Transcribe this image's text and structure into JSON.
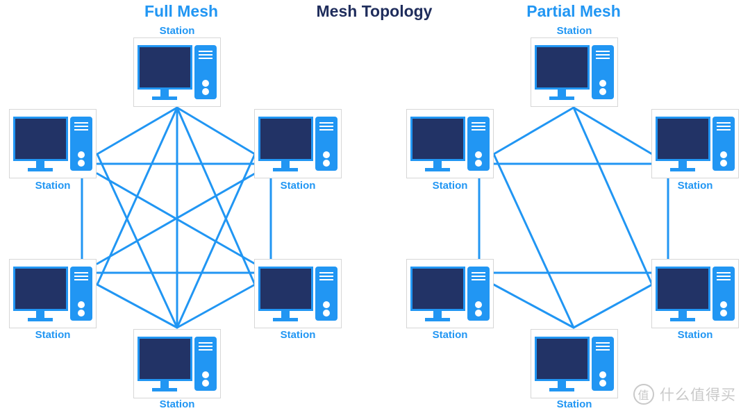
{
  "title": "Mesh Topology",
  "colors": {
    "accent": "#2196F3",
    "title": "#1F2D5C",
    "screen": "#223366"
  },
  "diagrams": [
    {
      "id": "full",
      "title": "Full Mesh",
      "nodes": [
        {
          "id": "top",
          "label": "Station"
        },
        {
          "id": "left-top",
          "label": "Station"
        },
        {
          "id": "right-top",
          "label": "Station"
        },
        {
          "id": "left-bottom",
          "label": "Station"
        },
        {
          "id": "right-bottom",
          "label": "Station"
        },
        {
          "id": "bottom",
          "label": "Station"
        }
      ],
      "edges": [
        [
          "top",
          "left-top"
        ],
        [
          "top",
          "right-top"
        ],
        [
          "top",
          "left-bottom"
        ],
        [
          "top",
          "right-bottom"
        ],
        [
          "top",
          "bottom"
        ],
        [
          "left-top",
          "right-top"
        ],
        [
          "left-top",
          "left-bottom"
        ],
        [
          "left-top",
          "right-bottom"
        ],
        [
          "left-top",
          "bottom"
        ],
        [
          "right-top",
          "left-bottom"
        ],
        [
          "right-top",
          "right-bottom"
        ],
        [
          "right-top",
          "bottom"
        ],
        [
          "left-bottom",
          "right-bottom"
        ],
        [
          "left-bottom",
          "bottom"
        ],
        [
          "right-bottom",
          "bottom"
        ]
      ]
    },
    {
      "id": "partial",
      "title": "Partial Mesh",
      "nodes": [
        {
          "id": "top",
          "label": "Station"
        },
        {
          "id": "left-top",
          "label": "Station"
        },
        {
          "id": "right-top",
          "label": "Station"
        },
        {
          "id": "left-bottom",
          "label": "Station"
        },
        {
          "id": "right-bottom",
          "label": "Station"
        },
        {
          "id": "bottom",
          "label": "Station"
        }
      ],
      "edges": [
        [
          "top",
          "left-top"
        ],
        [
          "top",
          "right-top"
        ],
        [
          "top",
          "right-bottom"
        ],
        [
          "left-top",
          "right-top"
        ],
        [
          "left-top",
          "left-bottom"
        ],
        [
          "left-top",
          "bottom"
        ],
        [
          "right-top",
          "right-bottom"
        ],
        [
          "left-bottom",
          "right-bottom"
        ],
        [
          "left-bottom",
          "bottom"
        ],
        [
          "right-bottom",
          "bottom"
        ]
      ]
    }
  ],
  "watermark": {
    "badge": "值",
    "text": "什么值得买"
  }
}
